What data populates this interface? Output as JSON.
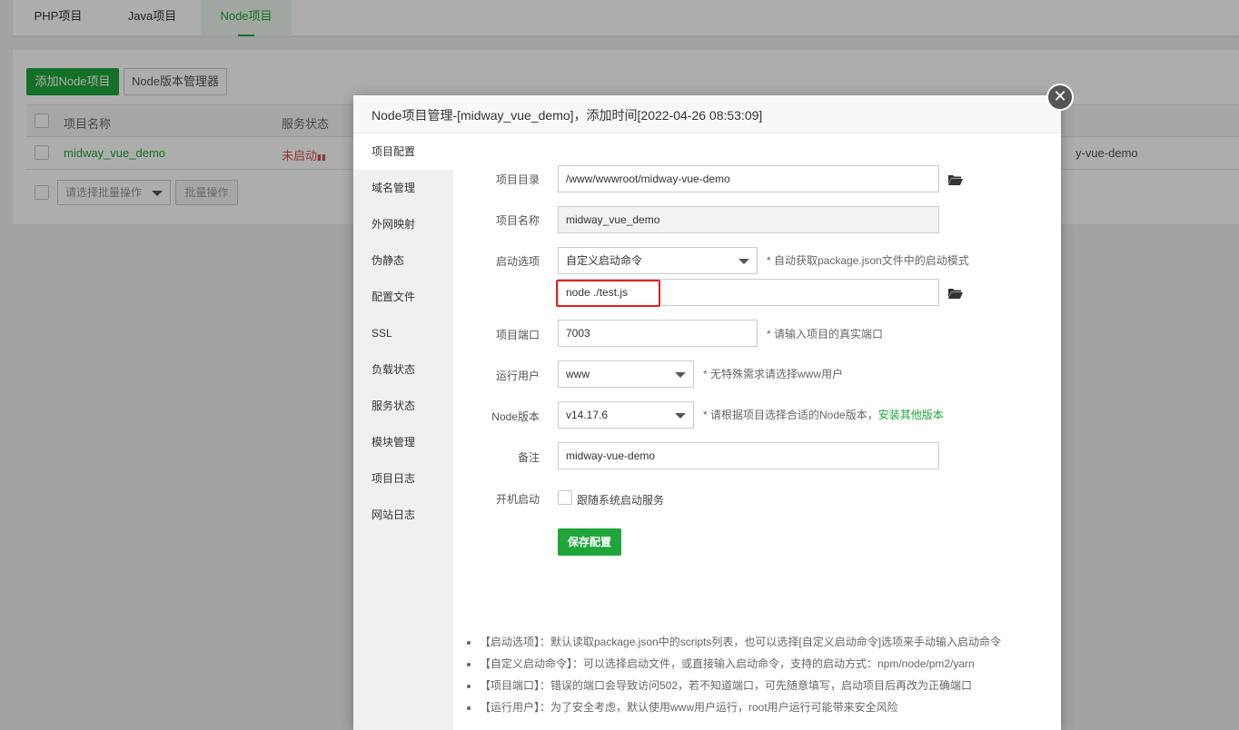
{
  "tabs": [
    "PHP项目",
    "Java项目",
    "Node项目"
  ],
  "toolbar": {
    "add_label": "添加Node项目",
    "version_mgr_label": "Node版本管理器"
  },
  "table": {
    "headers": [
      "项目名称",
      "服务状态"
    ],
    "row": {
      "name": "midway_vue_demo",
      "status": "未启动",
      "status_glyph": "▮▮",
      "path_fragment": "y-vue-demo"
    }
  },
  "batch": {
    "select_placeholder": "请选择批量操作",
    "apply_label": "批量操作"
  },
  "modal": {
    "title": "Node项目管理-[midway_vue_demo]，添加时间[2022-04-26 08:53:09]",
    "close_glyph": "✕",
    "menu": [
      "项目配置",
      "域名管理",
      "外网映射",
      "伪静态",
      "配置文件",
      "SSL",
      "负载状态",
      "服务状态",
      "模块管理",
      "项目日志",
      "网站日志"
    ],
    "form": {
      "dir_label": "项目目录",
      "dir_value": "/www/wwwroot/midway-vue-demo",
      "name_label": "项目名称",
      "name_value": "midway_vue_demo",
      "start_label": "启动选项",
      "start_value": "自定义启动命令",
      "start_hint": "* 自动获取package.json文件中的启动模式",
      "cmd_value": "node ./test.js",
      "port_label": "项目端口",
      "port_value": "7003",
      "port_hint": "* 请输入项目的真实端口",
      "user_label": "运行用户",
      "user_value": "www",
      "user_hint": "* 无特殊需求请选择www用户",
      "node_label": "Node版本",
      "node_value": "v14.17.6",
      "node_hint": "* 请根据项目选择合适的Node版本，",
      "node_link": "安装其他版本",
      "remark_label": "备注",
      "remark_value": "midway-vue-demo",
      "boot_label": "开机启动",
      "boot_text": "跟随系统启动服务",
      "save_label": "保存配置"
    },
    "notes": [
      "【启动选项】：默认读取package.json中的scripts列表，也可以选择[自定义启动命令]选项来手动输入启动命令",
      "【自定义启动命令】：可以选择启动文件，或直接输入启动命令，支持的启动方式：npm/node/pm2/yarn",
      "【项目端口】：错误的端口会导致访问502，若不知道端口，可先随意填写，启动项目后再改为正确端口",
      "【运行用户】：为了安全考虑，默认使用www用户运行，root用户运行可能带来安全风险"
    ]
  },
  "colors": {
    "accent": "#20a53a",
    "danger": "#e02020",
    "status_stopped": "#d9534f"
  }
}
